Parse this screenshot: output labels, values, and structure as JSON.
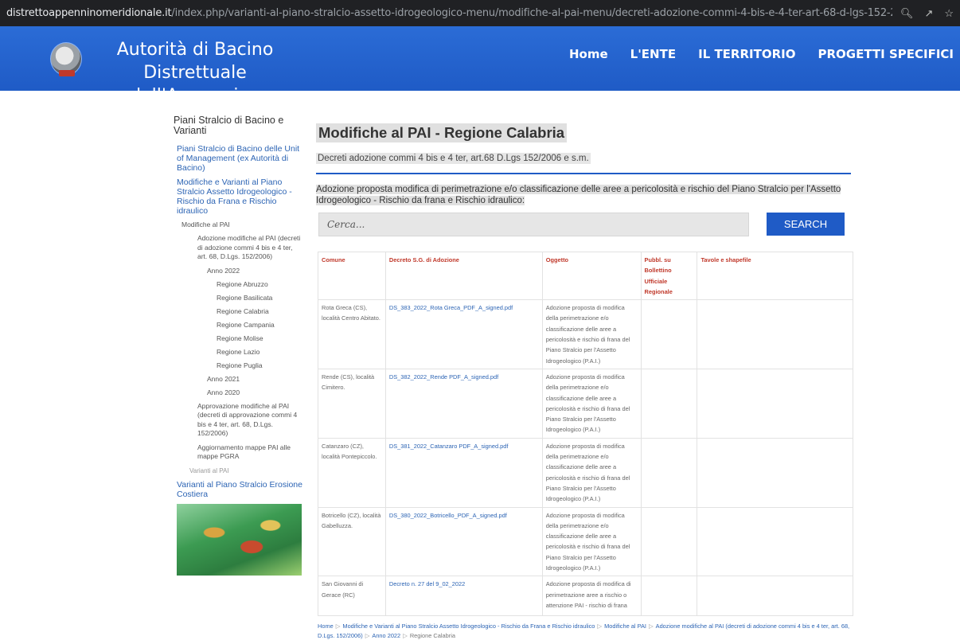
{
  "browser": {
    "url_host": "distrettoappenninomeridionale.it",
    "url_path": "/index.php/varianti-al-piano-stralcio-assetto-idrogeologico-menu/modifiche-al-pai-menu/decreti-adozione-commi-4-bis-e-4-ter-art-68-d-lgs-152-2006-menu/anno-2022-menu/regione-c...",
    "icons": [
      "zoom-icon",
      "share-icon",
      "star-icon"
    ]
  },
  "header": {
    "title_line1": "Autorità di Bacino Distrettuale",
    "title_line2": "dell'Appennino Meridionale",
    "nav": [
      "Home",
      "L'ENTE",
      "IL TERRITORIO",
      "PROGETTI SPECIFICI"
    ]
  },
  "sidebar": {
    "title": "Piani Stralcio di Bacino e Varianti",
    "items": [
      "Piani Stralcio di Bacino delle Unit of Management (ex Autorità di Bacino)",
      "Modifiche e Varianti al Piano Stralcio Assetto Idrogeologico - Rischio da Frana e Rischio idraulico",
      "Modifiche al PAI",
      "Adozione modifiche al PAI (decreti di adozione commi 4 bis e 4 ter, art. 68, D.Lgs. 152/2006)",
      "Anno 2022",
      "Regione Abruzzo",
      "Regione Basilicata",
      "Regione Calabria",
      "Regione Campania",
      "Regione Molise",
      "Regione Lazio",
      "Regione Puglia",
      "Anno 2021",
      "Anno 2020",
      "Approvazione modifiche al PAI (decreti di approvazione commi 4 bis e 4 ter, art. 68, D.Lgs. 152/2006)",
      "Aggiornamento mappe PAI alle mappe PGRA",
      "Varianti al PAI",
      "Varianti al Piano Stralcio Erosione Costiera"
    ]
  },
  "main": {
    "title": "Modifiche al PAI - Regione Calabria",
    "subtitle": "Decreti adozione commi 4 bis e 4 ter, art.68 D.Lgs 152/2006 e s.m.",
    "intro": "Adozione proposta modifica di perimetrazione e/o classificazione delle aree a pericolosità e  rischio del Piano Stralcio per l'Assetto Idrogeologico - Rischio da frana e Rischio idraulico:",
    "search_placeholder": "Cerca...",
    "search_button": "SEARCH",
    "table": {
      "headers": [
        "Comune",
        "Decreto S.G. di Adozione",
        "Oggetto",
        "Pubbl. su Bollettino Ufficiale Regionale",
        "Tavole e shapefile"
      ],
      "rows": [
        [
          "Rota Greca (CS), località Centro Abitato.",
          "DS_383_2022_Rota Greca_PDF_A_signed.pdf",
          "Adozione proposta di modifica della perimetrazione e/o classificazione delle aree a pericolosità e rischio di frana del Piano Stralcio per l'Assetto Idrogeologico (P.A.I.)",
          "",
          ""
        ],
        [
          "Rende (CS), località Cimitero.",
          "DS_382_2022_Rende PDF_A_signed.pdf",
          "Adozione proposta di modifica della perimetrazione e/o classificazione delle aree a pericolosità e rischio di frana del Piano Stralcio per l'Assetto Idrogeologico (P.A.I.)",
          "",
          ""
        ],
        [
          "Catanzaro (CZ), località Pontepiccolo.",
          "DS_381_2022_Catanzaro PDF_A_signed.pdf",
          "Adozione proposta di modifica della perimetrazione e/o classificazione delle aree a pericolosità e rischio di frana del Piano Stralcio per l'Assetto Idrogeologico (P.A.I.)",
          "",
          ""
        ],
        [
          "Botricello (CZ), località Gabelluzza.",
          "DS_380_2022_Botricello_PDF_A_signed.pdf",
          "Adozione proposta di modifica della perimetrazione e/o classificazione delle aree a pericolosità e rischio di frana del Piano Stralcio per l'Assetto Idrogeologico (P.A.I.)",
          "",
          ""
        ],
        [
          "San Giovanni di Gerace (RC)",
          "Decreto n. 27 del 9_02_2022",
          "Adozione proposta di modifica di perimetrazione aree a rischio o attenzione PAI - rischio di frana",
          "",
          ""
        ]
      ]
    },
    "breadcrumb": [
      "Home",
      "Modifiche e Varianti al Piano Stralcio Assetto Idrogeologico - Rischio da Frana e Rischio idraulico",
      "Modifiche al PAI",
      "Adozione modifiche al PAI (decreti di adozione commi 4 bis e 4 ter, art. 68, D.Lgs. 152/2006)",
      "Anno 2022",
      "Regione Calabria"
    ]
  },
  "colors": {
    "header_blue": "#1f5bc6",
    "link": "#2c64b4",
    "table_header": "#c0392b"
  }
}
